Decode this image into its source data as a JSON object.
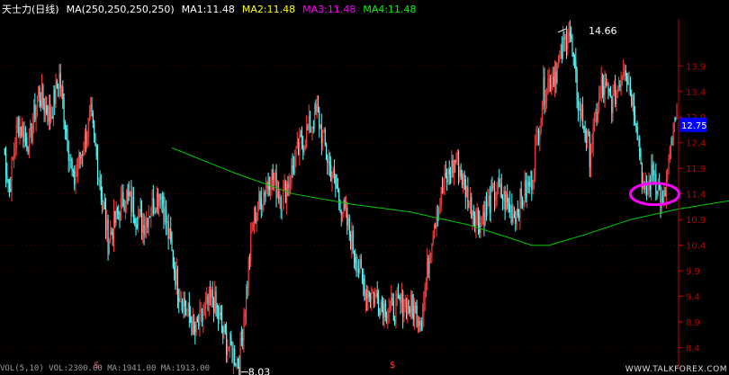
{
  "header": {
    "stock_name": "天士力(日线)",
    "ma_params": "MA(250,250,250,250)",
    "ma1": "MA1:11.48",
    "ma2": "MA2:11.48",
    "ma3": "MA3:11.48",
    "ma4": "MA4:11.48"
  },
  "colors": {
    "up": "#ff3b3b",
    "down": "#54ffff",
    "ma": "#00cc00",
    "axis": "#c00000",
    "grid": "#7a0000",
    "highlight_circle": "#ff00ff",
    "price_tag_bg": "#0000ff"
  },
  "annotations": {
    "high_label": "14.66",
    "low_label": "8.03",
    "current_price": "12.75",
    "marker_symbol": "$"
  },
  "sub_panel_text": "VOL(5,10)  VOL:2300.00  MA:1941.00  MA:1913.00",
  "watermark": "WWW.TALKFOREX.COM",
  "chart_data": {
    "type": "candlestick",
    "title": "天士力(日线)",
    "y_ticks": [
      "13.9",
      "13.4",
      "12.9",
      "12.4",
      "11.9",
      "11.4",
      "10.9",
      "10.4",
      "9.9",
      "9.4",
      "8.9",
      "8.4"
    ],
    "ylim": [
      8.2,
      14.8
    ],
    "high": 14.66,
    "low": 8.03,
    "last": 12.75,
    "grid": true,
    "pivots": [
      [
        0,
        12.3
      ],
      [
        5,
        11.5
      ],
      [
        12,
        12.8
      ],
      [
        22,
        12.4
      ],
      [
        30,
        13.4
      ],
      [
        40,
        12.9
      ],
      [
        48,
        13.7
      ],
      [
        60,
        11.6
      ],
      [
        75,
        12.9
      ],
      [
        90,
        10.5
      ],
      [
        105,
        11.4
      ],
      [
        120,
        10.8
      ],
      [
        135,
        11.5
      ],
      [
        150,
        9.6
      ],
      [
        165,
        8.7
      ],
      [
        180,
        9.4
      ],
      [
        192,
        8.5
      ],
      [
        203,
        8.1
      ],
      [
        215,
        10.9
      ],
      [
        230,
        11.8
      ],
      [
        240,
        11.3
      ],
      [
        255,
        12.3
      ],
      [
        270,
        13.0
      ],
      [
        280,
        12.0
      ],
      [
        295,
        10.9
      ],
      [
        310,
        9.6
      ],
      [
        320,
        9.4
      ],
      [
        335,
        9.1
      ],
      [
        345,
        9.3
      ],
      [
        360,
        9.0
      ],
      [
        370,
        10.8
      ],
      [
        380,
        11.6
      ],
      [
        390,
        12.1
      ],
      [
        402,
        11.2
      ],
      [
        410,
        10.9
      ],
      [
        425,
        11.5
      ],
      [
        440,
        11.0
      ],
      [
        455,
        11.7
      ],
      [
        465,
        13.4
      ],
      [
        478,
        13.9
      ],
      [
        487,
        14.66
      ],
      [
        495,
        13.2
      ],
      [
        505,
        12.2
      ],
      [
        515,
        13.5
      ],
      [
        525,
        13.2
      ],
      [
        535,
        14.0
      ],
      [
        545,
        12.9
      ],
      [
        552,
        11.3
      ],
      [
        560,
        11.9
      ],
      [
        568,
        11.1
      ],
      [
        578,
        12.75
      ]
    ],
    "ma_line": [
      [
        145,
        12.3
      ],
      [
        200,
        11.8
      ],
      [
        250,
        11.4
      ],
      [
        300,
        11.2
      ],
      [
        350,
        11.05
      ],
      [
        400,
        10.8
      ],
      [
        435,
        10.55
      ],
      [
        455,
        10.4
      ],
      [
        470,
        10.4
      ],
      [
        500,
        10.6
      ],
      [
        540,
        10.9
      ],
      [
        580,
        11.1
      ],
      [
        620,
        11.25
      ],
      [
        670,
        11.4
      ],
      [
        700,
        11.55
      ]
    ],
    "marker_x": [
      80,
      335
    ]
  }
}
